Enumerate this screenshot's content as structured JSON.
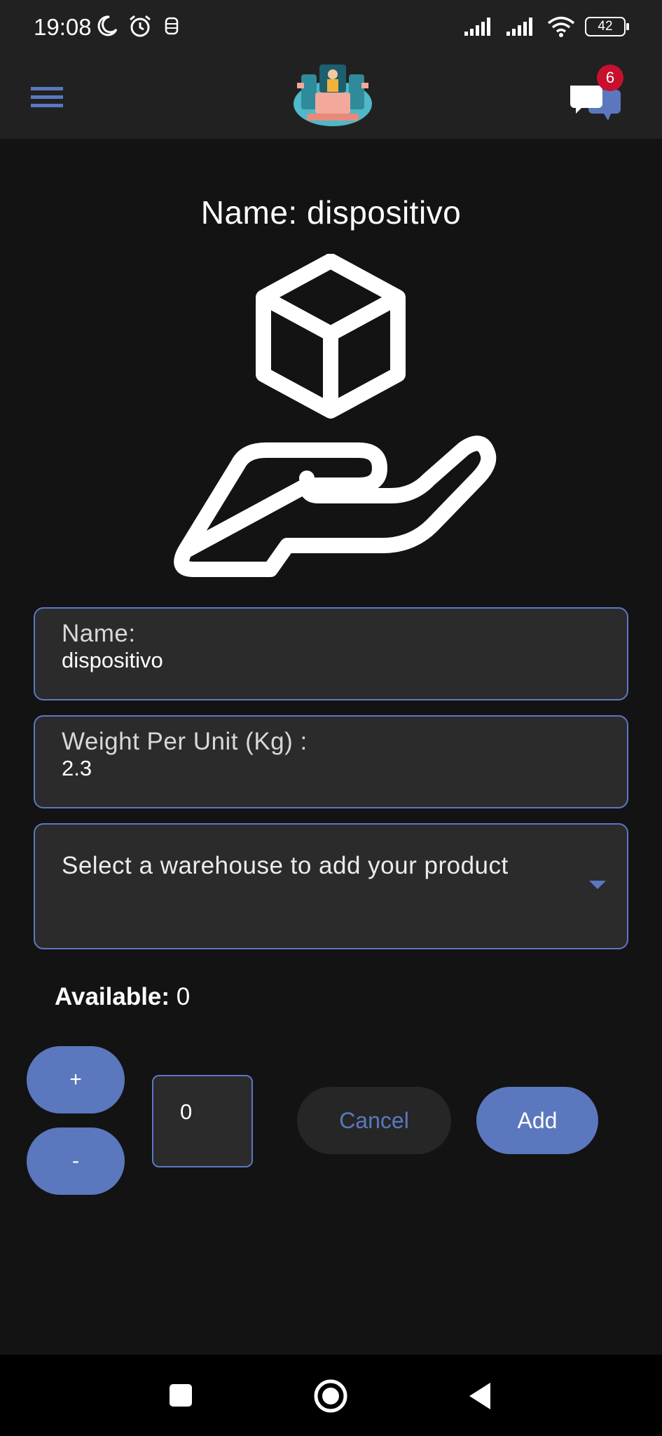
{
  "status_bar": {
    "time": "19:08",
    "battery": "42"
  },
  "header": {
    "chat_badge_count": "6"
  },
  "product": {
    "title": "Name: dispositivo"
  },
  "form": {
    "name_label": "Name:",
    "name_value": "dispositivo",
    "weight_label": "Weight Per Unit (Kg) :",
    "weight_value": "2.3",
    "warehouse_placeholder": "Select a warehouse to add your product"
  },
  "stock": {
    "available_label": "Available:",
    "available_value": "0"
  },
  "controls": {
    "plus_label": "+",
    "minus_label": "-",
    "quantity_value": "0",
    "cancel_label": "Cancel",
    "add_label": "Add"
  },
  "colors": {
    "accent": "#5b78be",
    "background": "#131313",
    "surface": "#2b2b2b",
    "badge": "#c8102e"
  },
  "icons": {
    "menu": "hamburger-menu-icon",
    "chat": "chat-bubbles-icon",
    "hero": "package-in-hand-icon"
  }
}
